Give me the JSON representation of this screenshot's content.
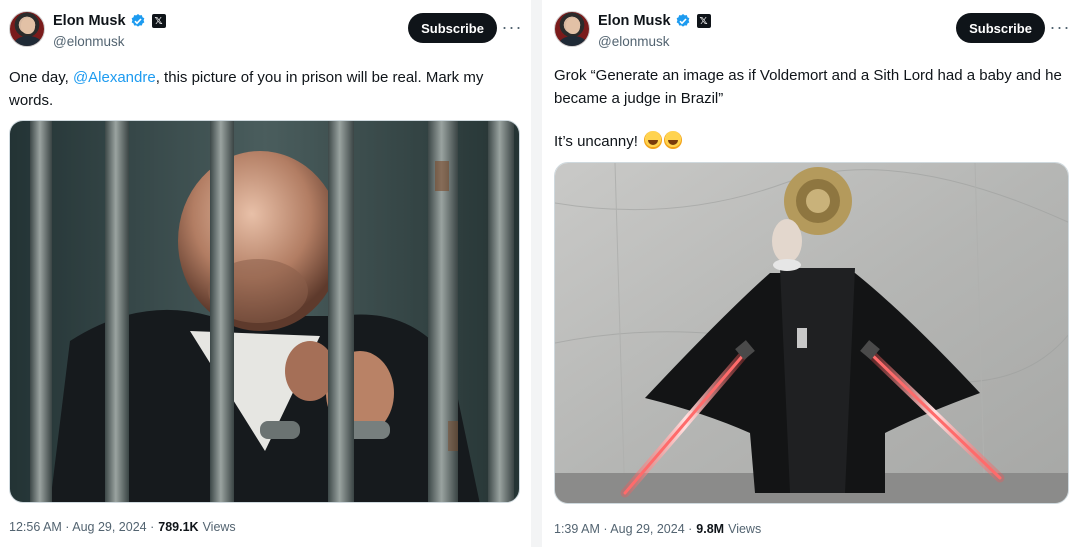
{
  "colors": {
    "accent": "#1d9bf0",
    "subscribe_bg": "#0f1419",
    "secondary_text": "#536471"
  },
  "left_tweet": {
    "name": "Elon Musk",
    "handle": "@elonmusk",
    "subscribe_label": "Subscribe",
    "more_label": "···",
    "text_before": "One day, ",
    "mention": "@Alexandre",
    "text_after": ", this picture of you in prison will be real. Mark my words.",
    "media_icon": "prison-image",
    "time": "12:56 AM · Aug 29, 2024 ·",
    "views_count": "789.1K",
    "views_label": "Views"
  },
  "right_tweet": {
    "name": "Elon Musk",
    "handle": "@elonmusk",
    "subscribe_label": "Subscribe",
    "more_label": "···",
    "text_line1": "Grok “Generate an image as if Voldemort and a Sith Lord had a baby and he became a judge in Brazil”",
    "text_line2": "It’s uncanny!",
    "emoji": "rolling-on-floor-laughing-emoji",
    "media_icon": "judge-lightsaber-image",
    "time": "1:39 AM · Aug 29, 2024 ·",
    "views_count": "9.8M",
    "views_label": "Views"
  }
}
